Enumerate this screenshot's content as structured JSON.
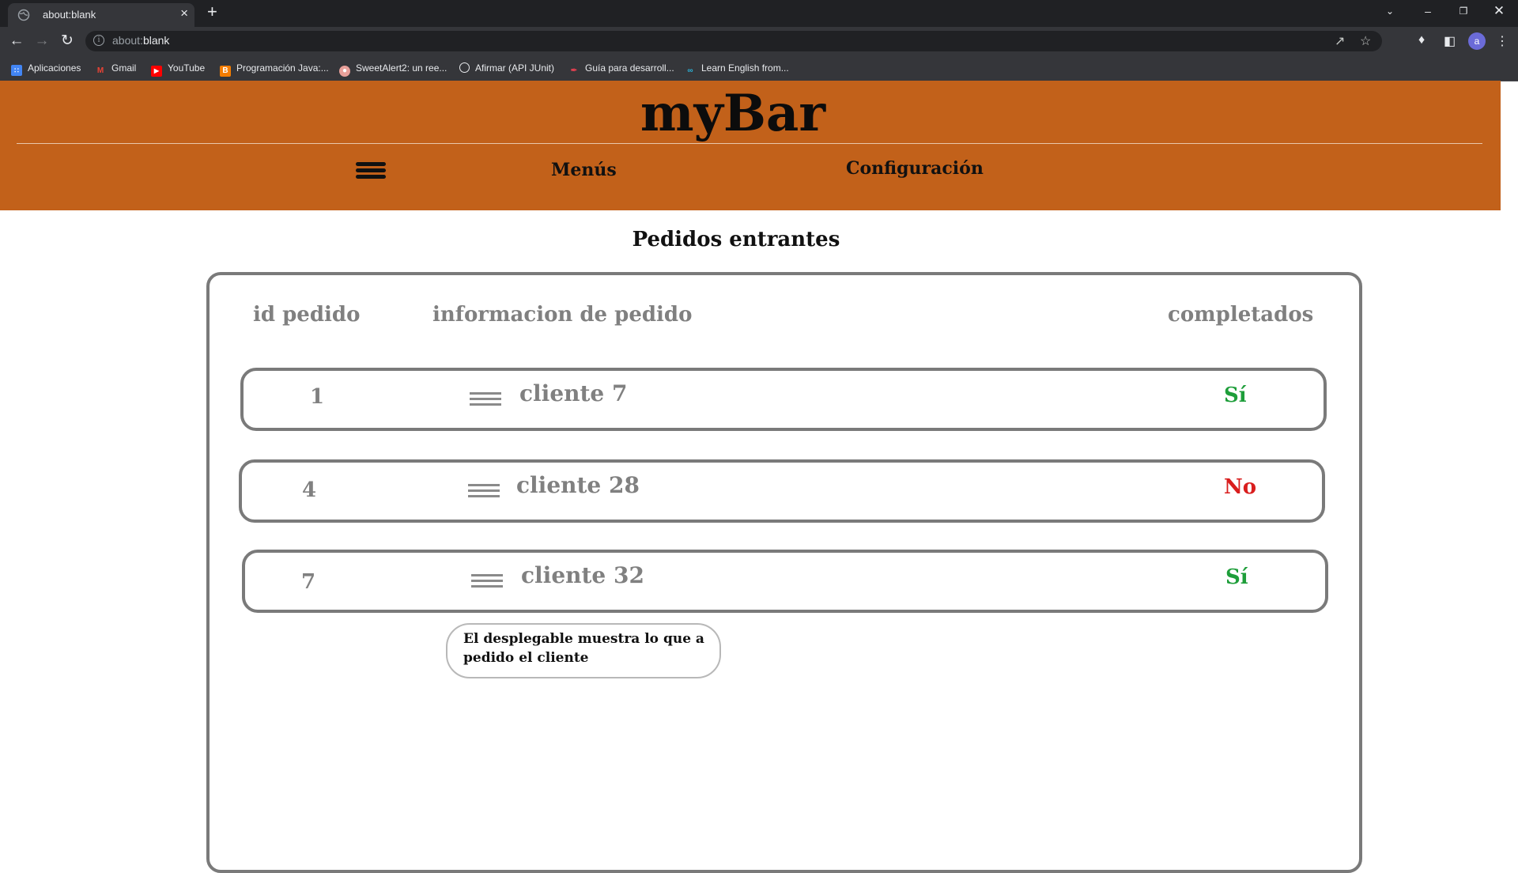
{
  "browser": {
    "tab_title": "about:blank",
    "url_prefix": "about:",
    "url_rest": "blank",
    "avatar_letter": "a",
    "bookmarks": [
      {
        "label": "Aplicaciones",
        "icon": "apps-grid-icon"
      },
      {
        "label": "Gmail",
        "icon": "gmail-icon"
      },
      {
        "label": "YouTube",
        "icon": "youtube-icon"
      },
      {
        "label": "Programación Java:...",
        "icon": "blogger-icon"
      },
      {
        "label": "SweetAlert2: un ree...",
        "icon": "sweetalert-icon"
      },
      {
        "label": "Afirmar (API JUnit)",
        "icon": "globe-icon"
      },
      {
        "label": "Guía para desarroll...",
        "icon": "feather-icon"
      },
      {
        "label": "Learn English from...",
        "icon": "learn-english-icon"
      }
    ]
  },
  "app": {
    "brand": "myBar",
    "nav": {
      "menus": "Menús",
      "config": "Configuración"
    },
    "section_title": "Pedidos entrantes",
    "columns": {
      "id": "id pedido",
      "info": "informacion de pedido",
      "done": "completados"
    },
    "orders": [
      {
        "id": "1",
        "client": "cliente 7",
        "done": "Sí"
      },
      {
        "id": "4",
        "client": "cliente 28",
        "done": "No"
      },
      {
        "id": "7",
        "client": "cliente 32",
        "done": "Sí"
      }
    ],
    "note": "El desplegable muestra lo que a pedido el cliente"
  },
  "colors": {
    "header": "#c2611a",
    "yes": "#1e9e3a",
    "no": "#d91e1e",
    "muted_text": "#808080"
  }
}
